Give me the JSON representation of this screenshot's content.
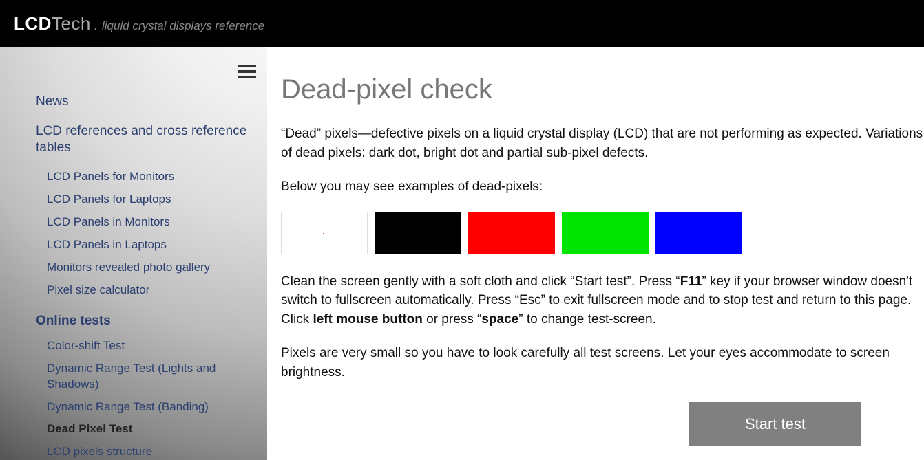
{
  "header": {
    "logo_lcd": "LCD",
    "logo_tech": "Tech",
    "logo_dot": ".",
    "tagline": "liquid crystal displays reference"
  },
  "sidebar": {
    "top_items": [
      "News",
      "LCD references and cross reference tables"
    ],
    "ref_sub": [
      "LCD Panels for Monitors",
      "LCD Panels for Laptops",
      "LCD Panels in Monitors",
      "LCD Panels in Laptops",
      "Monitors revealed photo gallery",
      "Pixel size calculator"
    ],
    "tests_heading": "Online tests",
    "tests_sub": [
      "Color-shift Test",
      "Dynamic Range Test (Lights and Shadows)",
      "Dynamic Range Test (Banding)",
      "Dead Pixel Test",
      "LCD pixels structure"
    ],
    "active_test_index": 3
  },
  "main": {
    "title": "Dead-pixel check",
    "intro": "“Dead” pixels—defective pixels on a liquid crystal display (LCD) that are not performing as expected. Variations of dead pixels: dark dot, bright dot and partial sub-pixel defects.",
    "examples_label": "Below you may see examples of dead-pixels:",
    "instructions_pre": "Clean the screen gently with a soft cloth and click “Start test”. Press “",
    "key_f11": "F11",
    "instructions_mid": "” key if your browser window doesn't switch to fullscreen automatically. Press “Esc” to exit fullscreen mode and to stop test and return to this page. Click ",
    "key_lmb": "left mouse button",
    "instructions_mid2": " or press “",
    "key_space": "space",
    "instructions_end": "” to change test-screen.",
    "accommodate": "Pixels are very small so you have to look carefully all test screens. Let your eyes accommodate to screen brightness.",
    "start_button": "Start test",
    "swatch_colors": [
      "#ffffff",
      "#000000",
      "#ff0000",
      "#00e500",
      "#0000ff"
    ]
  }
}
